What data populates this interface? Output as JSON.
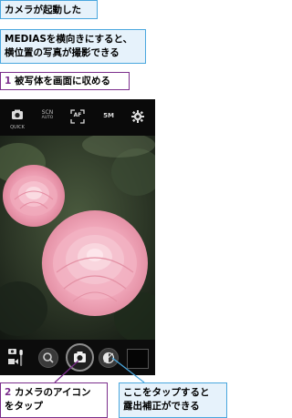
{
  "callouts": {
    "title": "カメラが起動した",
    "info_line1": "MEDIASを横向きにすると、",
    "info_line2": "横位置の写真が撮影できる",
    "step1_num": "1",
    "step1_text": "被写体を画面に収める",
    "step2_num": "2",
    "step2_line1": "カメラのアイコン",
    "step2_line2": "をタップ",
    "exposure_line1": "ここをタップすると",
    "exposure_line2": "露出補正ができる"
  },
  "camera_topbar": {
    "scene_label": "SCN",
    "scene_sub": "AUTO",
    "af_label": "AF",
    "resolution_label": "5M",
    "mode_sub": "QUICK"
  },
  "icons": {
    "mode": "camera-mode-icon",
    "scene": "scene-icon",
    "focus": "autofocus-icon",
    "settings": "gear-icon",
    "video_switch": "video-switch-icon",
    "search": "search-icon",
    "shutter": "camera-icon",
    "exposure": "exposure-icon",
    "thumbnail": "thumbnail-icon"
  },
  "colors": {
    "callout_blue_border": "#4aa7de",
    "callout_blue_fill": "#e6f2fb",
    "callout_purple": "#7b2e8c",
    "camera_ui_dark": "#0a0a0a"
  }
}
